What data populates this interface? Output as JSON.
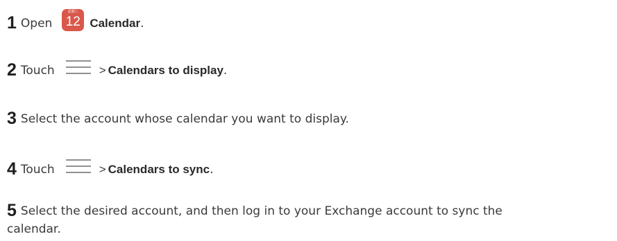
{
  "steps": [
    {
      "num": "1",
      "prefix": "Open",
      "bold": "Calendar",
      "suffix": "."
    },
    {
      "num": "2",
      "prefix": "Touch",
      "gt": ">",
      "bold": "Calendars to display",
      "suffix": "."
    },
    {
      "num": "3",
      "text": "Select the account whose calendar you want to display."
    },
    {
      "num": "4",
      "prefix": "Touch",
      "gt": ">",
      "bold": "Calendars to sync",
      "suffix": "."
    },
    {
      "num": "5",
      "text": "Select the desired account, and then log in to your Exchange account to sync the",
      "text2": "calendar."
    }
  ],
  "calendar_icon": {
    "header": "星期二",
    "day": "12",
    "color": "#d9574b"
  },
  "menu_icon": "menu-icon"
}
